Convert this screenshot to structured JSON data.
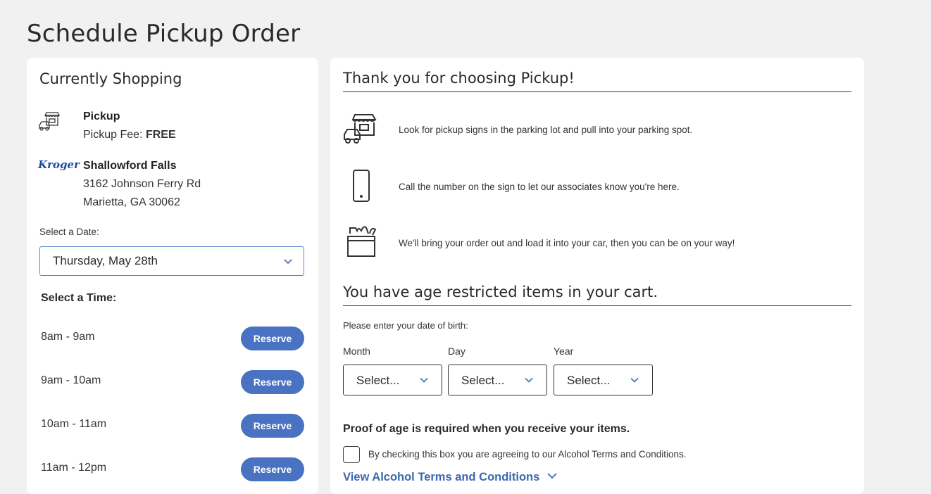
{
  "page": {
    "title": "Schedule Pickup Order"
  },
  "shopping": {
    "heading": "Currently Shopping",
    "mode_title": "Pickup",
    "fee_label": "Pickup Fee:",
    "fee_value": "FREE",
    "store_brand": "Kroger",
    "store_name": "Shallowford Falls",
    "store_address_1": "3162 Johnson Ferry Rd",
    "store_address_2": "Marietta, GA 30062",
    "date_label": "Select a Date:",
    "date_value": "Thursday, May 28th",
    "time_label": "Select a Time:",
    "slots": [
      {
        "time": "8am - 9am",
        "button": "Reserve"
      },
      {
        "time": "9am - 10am",
        "button": "Reserve"
      },
      {
        "time": "10am - 11am",
        "button": "Reserve"
      },
      {
        "time": "11am - 12pm",
        "button": "Reserve"
      }
    ]
  },
  "pickup_info": {
    "heading": "Thank you for choosing Pickup!",
    "steps": [
      {
        "icon": "curbside-car-icon",
        "text": "Look for pickup signs in the parking lot and pull into your parking spot."
      },
      {
        "icon": "phone-icon",
        "text": "Call the number on the sign to let our associates know you're here."
      },
      {
        "icon": "grocery-bag-icon",
        "text": "We'll bring your order out and load it into your car, then you can be on your way!"
      }
    ]
  },
  "age_restriction": {
    "heading": "You have age restricted items in your cart.",
    "prompt": "Please enter your date of birth:",
    "fields": [
      {
        "label": "Month",
        "value": "Select..."
      },
      {
        "label": "Day",
        "value": "Select..."
      },
      {
        "label": "Year",
        "value": "Select..."
      }
    ],
    "proof_text": "Proof of age is required when you receive your items.",
    "checkbox_text": "By checking this box you are agreeing to our Alcohol Terms and Conditions.",
    "terms_link": "View Alcohol Terms and Conditions"
  },
  "colors": {
    "accent": "#4a72c2",
    "link": "#3c67b0",
    "kroger_blue": "#1c4fa0",
    "background": "#f1f1f1"
  }
}
